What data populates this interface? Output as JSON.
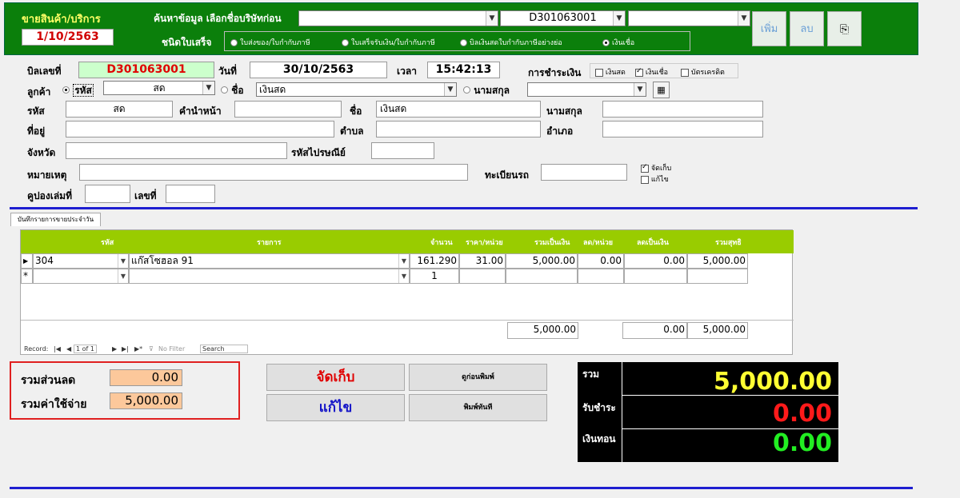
{
  "header": {
    "title": "ขายสินค้า/บริการ",
    "date": "1/10/2563",
    "search_label": "ค้นหาข้อมูล เลือกชื่อบริษัทก่อน",
    "invoice_select": "D301063001",
    "doc_type_label": "ชนิดใบเสร็จ",
    "doc_types": [
      "ใบส่งของ/ใบกำกับภาษี",
      "ใบเสร็จรับเงิน/ใบกำกับภาษี",
      "บิลเงินสดใบกำกับภาษีอย่างย่อ",
      "เงินเชื่อ"
    ],
    "add_label": "เพิ่ม",
    "delete_label": "ลบ"
  },
  "bill": {
    "bill_no_label": "บิลเลขที่",
    "bill_no": "D301063001",
    "date_label": "วันที่",
    "date": "30/10/2563",
    "time_label": "เวลา",
    "time": "15:42:13",
    "payment_label": "การชำระเงิน",
    "payment_options": [
      "เงินสด",
      "เงินเชื่อ",
      "บัตรเครดิต"
    ]
  },
  "customer": {
    "label": "ลูกค้า",
    "code_radio": "รหัส",
    "code_value": "สด",
    "name_radio": "ชื่อ",
    "name_value": "เงินสด",
    "surname_radio": "นามสกุล",
    "code_label": "รหัส",
    "code": "สด",
    "prefix_label": "คำนำหน้า",
    "name_label": "ชื่อ",
    "name": "เงินสด",
    "surname_label": "นามสกุล",
    "address_label": "ที่อยู่",
    "subdistrict_label": "ตำบล",
    "district_label": "อำเภอ",
    "province_label": "จังหวัด",
    "postal_label": "รหัสไปรษณีย์",
    "note_label": "หมายเหตุ",
    "plate_label": "ทะเบียนรถ",
    "save_chk": "จัดเก็บ",
    "edit_chk": "แก้ไข",
    "coupon_label": "คูปองเล่มที่",
    "number_label": "เลขที่"
  },
  "tab_label": "บันทึกรายการขายประจำวัน",
  "grid": {
    "columns": [
      "รหัส",
      "รายการ",
      "จำนวน",
      "ราคา/หน่วย",
      "รวมเป็นเงิน",
      "ลด/หน่วย",
      "ลดเป็นเงิน",
      "รวมสุทธิ"
    ],
    "rows": [
      {
        "code": "304",
        "item": "แก๊สโซฮอล 91",
        "qty": "161.290",
        "price": "31.00",
        "amount": "5,000.00",
        "disc_unit": "0.00",
        "disc_amt": "0.00",
        "net": "5,000.00"
      }
    ],
    "new_row_qty": "1",
    "new_row_marker": "*",
    "totals": {
      "amount": "5,000.00",
      "disc_amt": "0.00",
      "net": "5,000.00"
    },
    "record_label": "Record:",
    "record_pos": "1 of 1",
    "filter_label": "No Filter",
    "search_label": "Search"
  },
  "summary": {
    "discount_label": "รวมส่วนลด",
    "discount": "0.00",
    "expense_label": "รวมค่าใช้จ่าย",
    "expense": "5,000.00"
  },
  "buttons": {
    "save": "จัดเก็บ",
    "edit": "แก้ไข",
    "preview": "ดูก่อนพิมพ์",
    "print": "พิมพ์ทันที"
  },
  "totals_panel": {
    "total_label": "รวม",
    "total": "5,000.00",
    "paid_label": "รับชำระ",
    "paid": "0.00",
    "change_label": "เงินทอน",
    "change": "0.00"
  },
  "colors": {
    "header_green": "#0b7f0b",
    "grid_green": "#99cc00",
    "highlight_red": "#e02020",
    "orange_field": "#fcc89b"
  }
}
